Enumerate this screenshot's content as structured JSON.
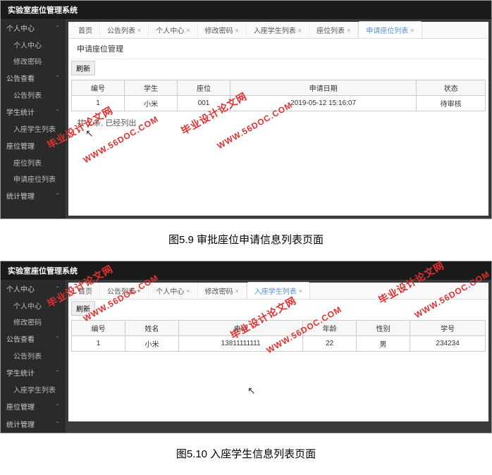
{
  "system_title": "实验室座位管理系统",
  "sidebar": {
    "items": [
      {
        "label": "个人中心",
        "type": "section"
      },
      {
        "label": "个人中心",
        "type": "item"
      },
      {
        "label": "修改密码",
        "type": "item"
      },
      {
        "label": "公告查看",
        "type": "section"
      },
      {
        "label": "公告列表",
        "type": "item"
      },
      {
        "label": "学生统计",
        "type": "section"
      },
      {
        "label": "入座学生列表",
        "type": "item"
      },
      {
        "label": "座位管理",
        "type": "section"
      },
      {
        "label": "座位列表",
        "type": "item"
      },
      {
        "label": "申请座位列表",
        "type": "item"
      },
      {
        "label": "统计管理",
        "type": "section"
      }
    ]
  },
  "sidebar2": {
    "items": [
      {
        "label": "个人中心",
        "type": "section"
      },
      {
        "label": "个人中心",
        "type": "item"
      },
      {
        "label": "修改密码",
        "type": "item"
      },
      {
        "label": "公告查看",
        "type": "section"
      },
      {
        "label": "公告列表",
        "type": "item"
      },
      {
        "label": "学生统计",
        "type": "section"
      },
      {
        "label": "入座学生列表",
        "type": "item"
      },
      {
        "label": "座位管理",
        "type": "section"
      },
      {
        "label": "统计管理",
        "type": "section"
      }
    ]
  },
  "tabs1": [
    {
      "label": "首页",
      "closable": false
    },
    {
      "label": "公告列表",
      "closable": true
    },
    {
      "label": "个人中心",
      "closable": true
    },
    {
      "label": "修改密码",
      "closable": true
    },
    {
      "label": "入座学生列表",
      "closable": true
    },
    {
      "label": "座位列表",
      "closable": true
    },
    {
      "label": "申请座位列表",
      "closable": true,
      "active": true
    }
  ],
  "tabs2": [
    {
      "label": "首页",
      "closable": false
    },
    {
      "label": "公告列表",
      "closable": true
    },
    {
      "label": "个人中心",
      "closable": true
    },
    {
      "label": "修改密码",
      "closable": true
    },
    {
      "label": "入座学生列表",
      "closable": true,
      "active": true
    }
  ],
  "page1": {
    "title": "申请座位管理",
    "refresh": "刷新",
    "headers": [
      "编号",
      "学生",
      "座位",
      "申请日期",
      "状态"
    ],
    "rows": [
      [
        "1",
        "小米",
        "001",
        "2019-05-12 15:16:07",
        "待审核"
      ]
    ],
    "summary": "共 1 条, 已经列出"
  },
  "page2": {
    "refresh": "刷新",
    "headers": [
      "编号",
      "姓名",
      "电话",
      "年龄",
      "性别",
      "学号"
    ],
    "rows": [
      [
        "1",
        "小米",
        "13811111111",
        "22",
        "男",
        "234234"
      ]
    ]
  },
  "caption1": "图5.9 审批座位申请信息列表页面",
  "caption2": "图5.10 入座学生信息列表页面",
  "watermark_cn": "毕业设计论文网",
  "watermark_en": "WWW.56DOC.COM"
}
